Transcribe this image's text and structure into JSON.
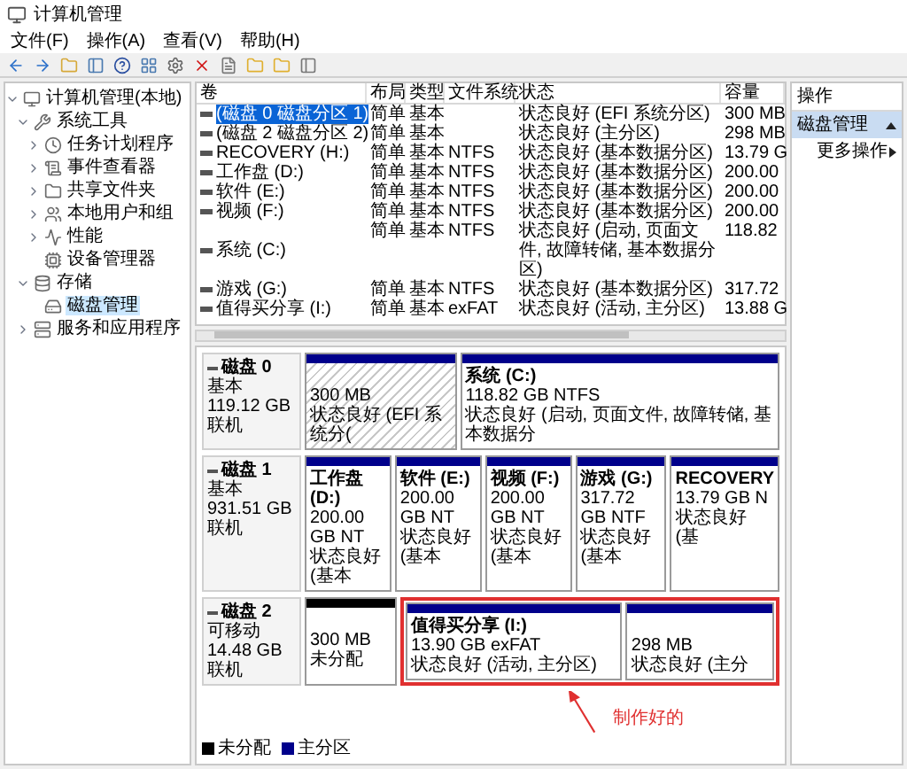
{
  "window": {
    "title": "计算机管理"
  },
  "menu": [
    "文件(F)",
    "操作(A)",
    "查看(V)",
    "帮助(H)"
  ],
  "tree": [
    {
      "label": "计算机管理(本地)",
      "kind": "computer",
      "expanded": true,
      "selected": false,
      "children": [
        {
          "label": "系统工具",
          "kind": "tools",
          "expanded": true,
          "selected": false,
          "children": [
            {
              "label": "任务计划程序",
              "kind": "clock",
              "expanded": false,
              "selected": false
            },
            {
              "label": "事件查看器",
              "kind": "log",
              "expanded": false,
              "selected": false
            },
            {
              "label": "共享文件夹",
              "kind": "folder",
              "expanded": false,
              "selected": false
            },
            {
              "label": "本地用户和组",
              "kind": "users",
              "expanded": false,
              "selected": false
            },
            {
              "label": "性能",
              "kind": "perf",
              "expanded": false,
              "selected": false
            },
            {
              "label": "设备管理器",
              "kind": "device",
              "selected": false
            }
          ]
        },
        {
          "label": "存储",
          "kind": "storage",
          "expanded": true,
          "selected": false,
          "children": [
            {
              "label": "磁盘管理",
              "kind": "disk",
              "selected": true
            }
          ]
        },
        {
          "label": "服务和应用程序",
          "kind": "services",
          "expanded": false,
          "selected": false
        }
      ]
    }
  ],
  "table": {
    "columns": [
      "卷",
      "布局",
      "类型",
      "文件系统",
      "状态",
      "容量"
    ],
    "rows": [
      {
        "cells": [
          "(磁盘 0 磁盘分区 1)",
          "简单",
          "基本",
          "",
          "状态良好 (EFI 系统分区)",
          "300 MB"
        ],
        "selected": true
      },
      {
        "cells": [
          "(磁盘 2 磁盘分区 2)",
          "简单",
          "基本",
          "",
          "状态良好 (主分区)",
          "298 MB"
        ],
        "selected": false
      },
      {
        "cells": [
          "RECOVERY (H:)",
          "简单",
          "基本",
          "NTFS",
          "状态良好 (基本数据分区)",
          "13.79 G"
        ],
        "selected": false
      },
      {
        "cells": [
          "工作盘 (D:)",
          "简单",
          "基本",
          "NTFS",
          "状态良好 (基本数据分区)",
          "200.00"
        ],
        "selected": false
      },
      {
        "cells": [
          "软件 (E:)",
          "简单",
          "基本",
          "NTFS",
          "状态良好 (基本数据分区)",
          "200.00"
        ],
        "selected": false
      },
      {
        "cells": [
          "视频 (F:)",
          "简单",
          "基本",
          "NTFS",
          "状态良好 (基本数据分区)",
          "200.00"
        ],
        "selected": false
      },
      {
        "cells": [
          "系统 (C:)",
          "简单",
          "基本",
          "NTFS",
          "状态良好 (启动, 页面文件, 故障转储, 基本数据分区)",
          "118.82"
        ],
        "selected": false
      },
      {
        "cells": [
          "游戏 (G:)",
          "简单",
          "基本",
          "NTFS",
          "状态良好 (基本数据分区)",
          "317.72"
        ],
        "selected": false
      },
      {
        "cells": [
          "值得买分享 (I:)",
          "简单",
          "基本",
          "exFAT",
          "状态良好 (活动, 主分区)",
          "13.88 G"
        ],
        "selected": false
      }
    ]
  },
  "disks": [
    {
      "name": "磁盘 0",
      "type": "基本",
      "size": "119.12 GB",
      "status": "联机",
      "partitions": [
        {
          "kind": "primary",
          "selected": true,
          "highlighted": false,
          "lines": [
            "300 MB",
            "状态良好 (EFI 系统分("
          ]
        },
        {
          "kind": "primary",
          "selected": false,
          "highlighted": false,
          "title": "系统  (C:)",
          "lines": [
            "118.82 GB NTFS",
            "状态良好 (启动, 页面文件, 故障转储, 基本数据分"
          ]
        }
      ]
    },
    {
      "name": "磁盘 1",
      "type": "基本",
      "size": "931.51 GB",
      "status": "联机",
      "partitions": [
        {
          "kind": "primary",
          "selected": false,
          "highlighted": false,
          "title": "工作盘  (D:)",
          "lines": [
            "200.00 GB NT",
            "状态良好 (基本"
          ]
        },
        {
          "kind": "primary",
          "selected": false,
          "highlighted": false,
          "title": "软件  (E:)",
          "lines": [
            "200.00 GB NT",
            "状态良好 (基本"
          ]
        },
        {
          "kind": "primary",
          "selected": false,
          "highlighted": false,
          "title": "视频  (F:)",
          "lines": [
            "200.00 GB NT",
            "状态良好 (基本"
          ]
        },
        {
          "kind": "primary",
          "selected": false,
          "highlighted": false,
          "title": "游戏  (G:)",
          "lines": [
            "317.72 GB NTF",
            "状态良好 (基本"
          ]
        },
        {
          "kind": "primary",
          "selected": false,
          "highlighted": false,
          "title": "RECOVERY",
          "lines": [
            "13.79 GB N",
            "状态良好 (基"
          ]
        }
      ]
    },
    {
      "name": "磁盘 2",
      "type": "可移动",
      "size": "14.48 GB",
      "status": "联机",
      "partitions": [
        {
          "kind": "unallocated",
          "selected": false,
          "highlighted": false,
          "lines": [
            "300 MB",
            "未分配"
          ]
        },
        {
          "kind": "primary",
          "selected": false,
          "highlighted": true,
          "title": "值得买分享  (I:)",
          "lines": [
            "13.90 GB exFAT",
            "状态良好 (活动, 主分区)"
          ]
        },
        {
          "kind": "primary",
          "selected": false,
          "highlighted": true,
          "lines": [
            "298 MB",
            "状态良好 (主分"
          ]
        }
      ]
    }
  ],
  "annotation": {
    "text": "制作好的"
  },
  "legend": [
    {
      "label": "未分配",
      "color": "#000000"
    },
    {
      "label": "主分区",
      "color": "#00008b"
    }
  ],
  "actions": {
    "header": "操作",
    "section": {
      "label": "磁盘管理",
      "expanded": true
    },
    "items": [
      {
        "label": "更多操作",
        "kind": "submenu"
      }
    ]
  }
}
